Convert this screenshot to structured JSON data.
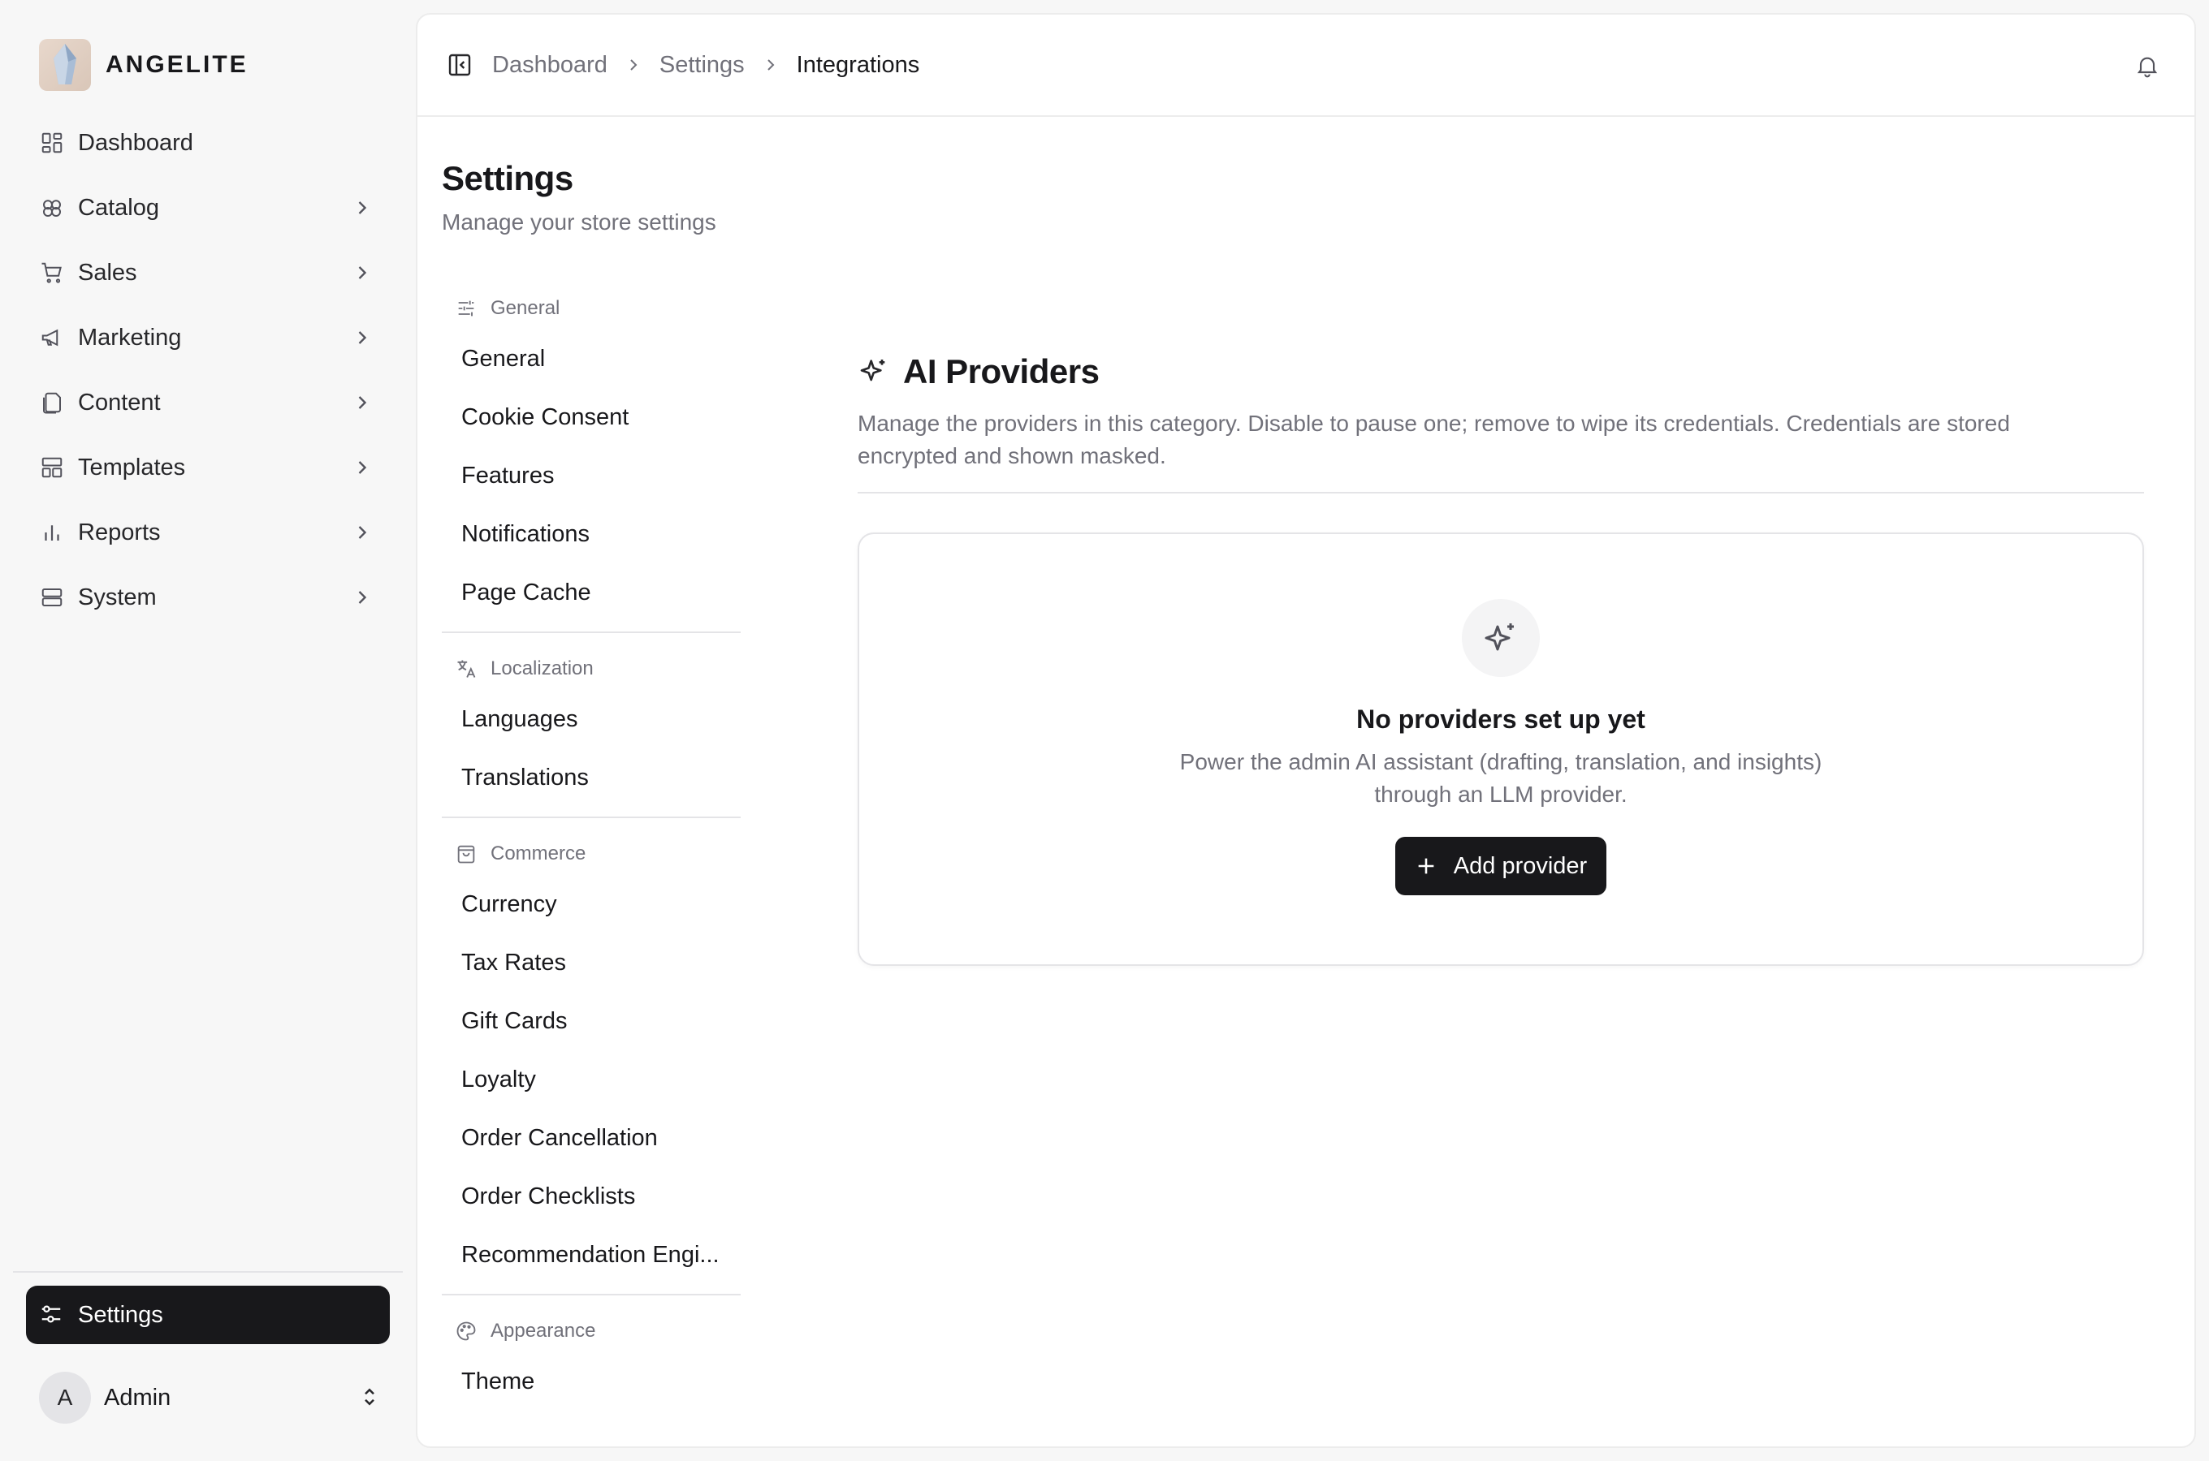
{
  "brand": {
    "name": "ANGELITE"
  },
  "sidebar": {
    "items": [
      {
        "label": "Dashboard",
        "icon": "dashboard-icon",
        "has_children": false
      },
      {
        "label": "Catalog",
        "icon": "catalog-icon",
        "has_children": true
      },
      {
        "label": "Sales",
        "icon": "cart-icon",
        "has_children": true
      },
      {
        "label": "Marketing",
        "icon": "megaphone-icon",
        "has_children": true
      },
      {
        "label": "Content",
        "icon": "files-icon",
        "has_children": true
      },
      {
        "label": "Templates",
        "icon": "layout-icon",
        "has_children": true
      },
      {
        "label": "Reports",
        "icon": "bar-chart-icon",
        "has_children": true
      },
      {
        "label": "System",
        "icon": "server-icon",
        "has_children": true
      }
    ],
    "active": {
      "label": "Settings",
      "icon": "settings-sliders-icon"
    },
    "user": {
      "initial": "A",
      "name": "Admin"
    }
  },
  "header": {
    "breadcrumb": [
      "Dashboard",
      "Settings",
      "Integrations"
    ]
  },
  "page": {
    "title": "Settings",
    "subtitle": "Manage your store settings"
  },
  "subnav": {
    "groups": [
      {
        "title": "General",
        "icon": "sliders-icon",
        "items": [
          "General",
          "Cookie Consent",
          "Features",
          "Notifications",
          "Page Cache"
        ]
      },
      {
        "title": "Localization",
        "icon": "translate-icon",
        "items": [
          "Languages",
          "Translations"
        ]
      },
      {
        "title": "Commerce",
        "icon": "shopping-bag-icon",
        "items": [
          "Currency",
          "Tax Rates",
          "Gift Cards",
          "Loyalty",
          "Order Cancellation",
          "Order Checklists",
          "Recommendation Engi..."
        ]
      },
      {
        "title": "Appearance",
        "icon": "palette-icon",
        "items": [
          "Theme"
        ]
      }
    ]
  },
  "providers": {
    "title": "AI Providers",
    "description": "Manage the providers in this category. Disable to pause one; remove to wipe its credentials. Credentials are stored encrypted and shown masked.",
    "empty": {
      "title": "No providers set up yet",
      "description": "Power the admin AI assistant (drafting, translation, and insights) through an LLM provider.",
      "button": "Add provider"
    }
  }
}
